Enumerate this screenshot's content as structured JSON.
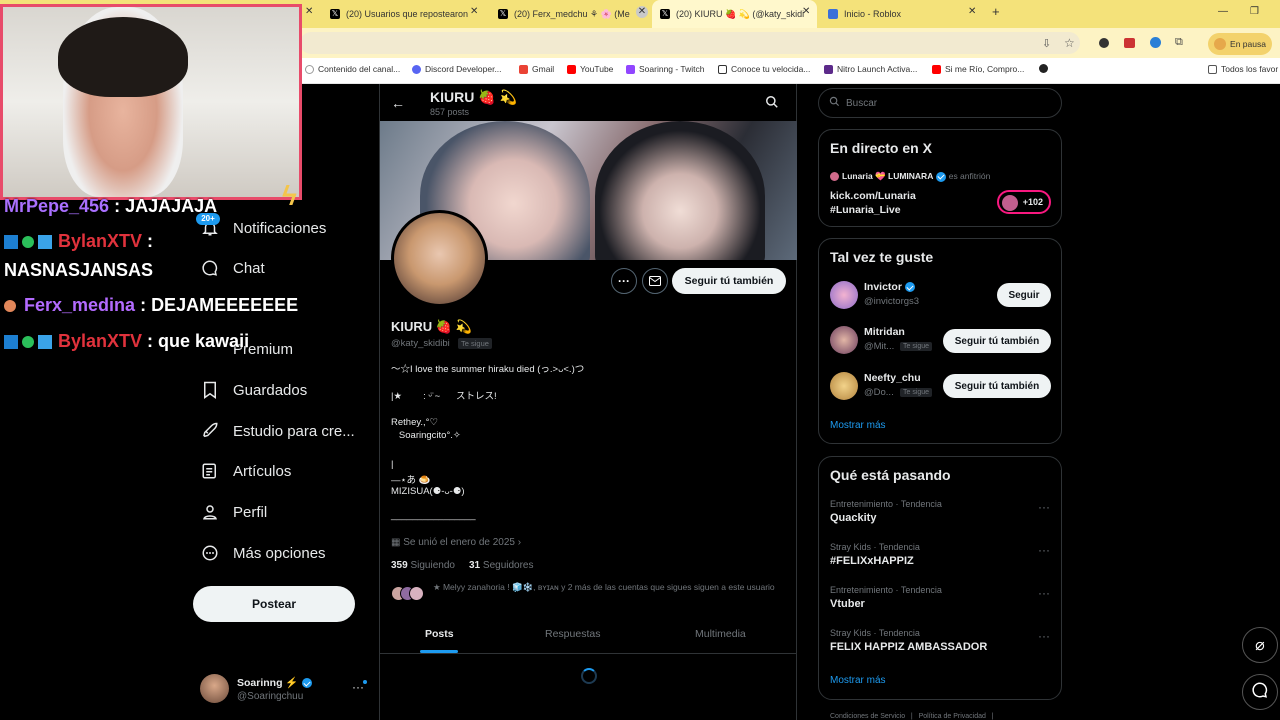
{
  "browser": {
    "tabs": [
      {
        "label": "(20) Usuarios que repostearon",
        "icon": "x-icon"
      },
      {
        "label": "(20) Ferx_medchu ⚘ 🌸 (Me e",
        "icon": "x-icon"
      },
      {
        "label": "(20) KIURU 🍓 💫 (@katy_skidi",
        "icon": "x-icon",
        "active": true
      },
      {
        "label": "Inicio - Roblox",
        "icon": "roblox-icon"
      }
    ],
    "new_tab": "+",
    "paused_label": "En pausa",
    "bookmarks": [
      "Contenido del canal...",
      "Discord Developer...",
      "Gmail",
      "YouTube",
      "Soarinng - Twitch",
      "Conoce tu velocida...",
      "Nitro Launch Activa...",
      "Si me Río, Compro...",
      "Todos los favor"
    ]
  },
  "stream_chat": [
    {
      "user": "MrPepe_456",
      "sep": " : ",
      "msg": "JAJAJAJA",
      "color": "#a970ff"
    },
    {
      "user": "BylanXTV",
      "sep": " :",
      "msg": "",
      "color": "#e0323c"
    },
    {
      "user": "",
      "sep": "",
      "msg": "NASNASJANSAS",
      "color": "#fff"
    },
    {
      "user": "Ferx_medina",
      "sep": " : ",
      "msg": "DEJAMEEEEEEE",
      "color": "#b36bff"
    },
    {
      "user": "BylanXTV",
      "sep": " : ",
      "msg": "que kawaii",
      "color": "#e0323c"
    }
  ],
  "stream_badge": "20+",
  "nav": {
    "items": [
      "Notificaciones",
      "Chat",
      "Premium",
      "Guardados",
      "Estudio para cre...",
      "Artículos",
      "Perfil",
      "Más opciones"
    ],
    "post_label": "Postear",
    "account_name": "Soarinng ⚡",
    "account_handle": "@Soaringchuu"
  },
  "profile": {
    "name": "KIURU 🍓 💫",
    "posts_count": "857 posts",
    "handle": "@katy_skidibi",
    "follows_you": "Te sigue",
    "follow_back_label": "Seguir tú también",
    "bio_lines": [
      "～☆I love the summer hiraku died (っ.˃ᴗ˂.)つ",
      "|★        : ᵕ̈ ~      ストレス!",
      "Rethey.,°♡",
      "   Soaringcito°.✧",
      "|",
      "—⋆あ 🍮",
      "MIZISUA(⚈-ᴗ-⚈)",
      "________________"
    ],
    "joined": "Se unió el enero de 2025",
    "following_count": "359",
    "following_label": "Siguiendo",
    "followers_count": "31",
    "followers_label": "Seguidores",
    "followed_by": "★ Melyy zanahoria ! 🧊❄️, ʙʏɪᴀɴ y 2 más de las cuentas que sigues siguen a este usuario",
    "tabs": [
      "Posts",
      "Respuestas",
      "Multimedia"
    ]
  },
  "search_placeholder": "Buscar",
  "live": {
    "title": "En directo en X",
    "host": "Lunaria 💝 LUMINARA",
    "host_suffix": "es anfitrión",
    "line1": "kick.com/Lunaria",
    "line2": "#Lunaria_Live",
    "listeners": "+102"
  },
  "suggestions": {
    "title": "Tal vez te guste",
    "items": [
      {
        "name": "Invictor",
        "handle": "@invictorgs3",
        "verified": true,
        "button": "Seguir",
        "follows_you": ""
      },
      {
        "name": "Mitridan",
        "handle": "@Mit...",
        "verified": false,
        "button": "Seguir tú también",
        "follows_you": "Te sigue"
      },
      {
        "name": "Neefty_chu",
        "handle": "@Do...",
        "verified": false,
        "button": "Seguir tú también",
        "follows_you": "Te sigue"
      }
    ],
    "show_more": "Mostrar más"
  },
  "trends": {
    "title": "Qué está pasando",
    "items": [
      {
        "category": "Entretenimiento · Tendencia",
        "name": "Quackity"
      },
      {
        "category": "Stray Kids · Tendencia",
        "name": "#FELIXxHAPPIZ"
      },
      {
        "category": "Entretenimiento · Tendencia",
        "name": "Vtuber"
      },
      {
        "category": "Stray Kids · Tendencia",
        "name": "FELIX HAPPIZ AMBASSADOR"
      }
    ],
    "show_more": "Mostrar más"
  },
  "footer": "Condiciones de Servicio   |   Política de Privacidad   |"
}
